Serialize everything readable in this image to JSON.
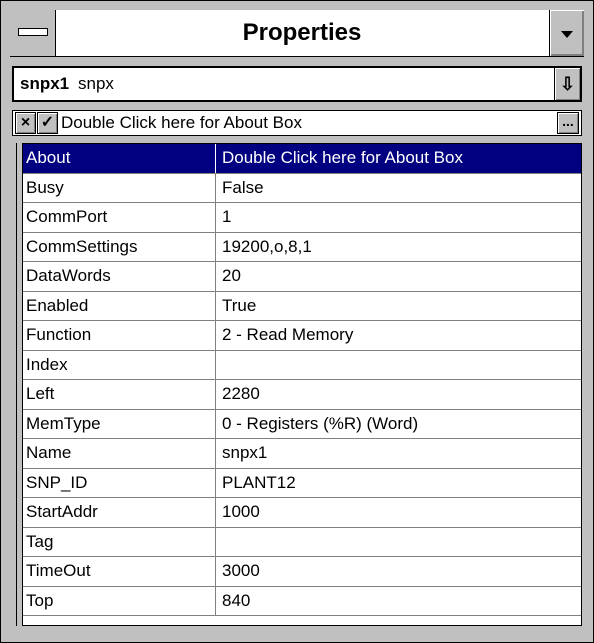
{
  "window": {
    "title": "Properties",
    "sysmenu_icon": "system-menu-bar-icon",
    "minimize_icon": "down-triangle-icon"
  },
  "object_selector": {
    "name": "snpx1",
    "type": "snpx",
    "dropdown_icon": "dropdown-arrow-icon",
    "dropdown_glyph": "⇩"
  },
  "edit_bar": {
    "cancel_glyph": "×",
    "ok_glyph": "✓",
    "value": "Double Click here for About Box",
    "ellipsis_label": "..."
  },
  "properties": [
    {
      "name": "About",
      "value": "Double Click here for About Box"
    },
    {
      "name": "Busy",
      "value": "False"
    },
    {
      "name": "CommPort",
      "value": "1"
    },
    {
      "name": "CommSettings",
      "value": "19200,o,8,1"
    },
    {
      "name": "DataWords",
      "value": "20"
    },
    {
      "name": "Enabled",
      "value": "True"
    },
    {
      "name": "Function",
      "value": "2 - Read Memory"
    },
    {
      "name": "Index",
      "value": ""
    },
    {
      "name": "Left",
      "value": "2280"
    },
    {
      "name": "MemType",
      "value": "0 - Registers (%R) (Word)"
    },
    {
      "name": "Name",
      "value": "snpx1"
    },
    {
      "name": "SNP_ID",
      "value": "PLANT12"
    },
    {
      "name": "StartAddr",
      "value": "1000"
    },
    {
      "name": "Tag",
      "value": ""
    },
    {
      "name": "TimeOut",
      "value": "3000"
    },
    {
      "name": "Top",
      "value": "840"
    }
  ],
  "selected_property": "About",
  "colors": {
    "selection_bg": "#000080",
    "selection_fg": "#ffffff",
    "face": "#c0c0c0"
  }
}
